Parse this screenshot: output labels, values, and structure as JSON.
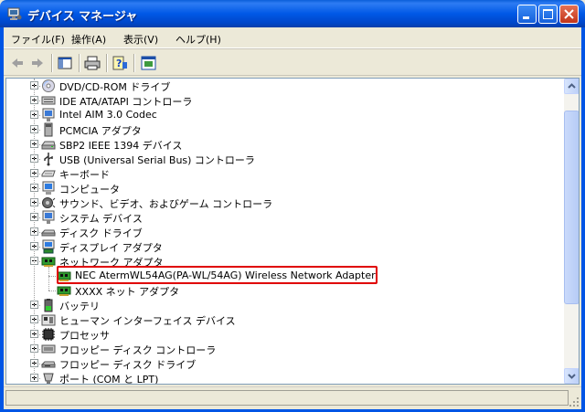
{
  "window": {
    "title": "デバイス マネージャ",
    "icon": "device-manager-icon"
  },
  "menu": [
    {
      "label": "ファイル(F)",
      "name": "menu-file"
    },
    {
      "label": "操作(A)",
      "name": "menu-action"
    },
    {
      "label": "表示(V)",
      "name": "menu-view"
    },
    {
      "label": "ヘルプ(H)",
      "name": "menu-help"
    }
  ],
  "toolbar": [
    {
      "name": "back-button",
      "icon": "arrow-left-icon"
    },
    {
      "name": "forward-button",
      "icon": "arrow-right-icon"
    },
    {
      "name": "show-hide-tree-button",
      "icon": "console-tree-icon"
    },
    {
      "name": "print-button",
      "icon": "printer-icon"
    },
    {
      "name": "help-button",
      "icon": "help-icon"
    },
    {
      "name": "properties-button",
      "icon": "properties-icon"
    }
  ],
  "tree": {
    "items": [
      {
        "label": "DVD/CD-ROM ドライブ",
        "icon": "cdrom-icon",
        "expander": "plus",
        "level": 1
      },
      {
        "label": "IDE ATA/ATAPI コントローラ",
        "icon": "ide-controller-icon",
        "expander": "plus",
        "level": 1
      },
      {
        "label": "Intel AIM 3.0 Codec",
        "icon": "monitor-icon",
        "expander": "plus",
        "level": 1
      },
      {
        "label": "PCMCIA アダプタ",
        "icon": "pcmcia-icon",
        "expander": "plus",
        "level": 1
      },
      {
        "label": "SBP2 IEEE 1394 デバイス",
        "icon": "drive-icon",
        "expander": "plus",
        "level": 1
      },
      {
        "label": "USB (Universal Serial Bus) コントローラ",
        "icon": "usb-icon",
        "expander": "plus",
        "level": 1
      },
      {
        "label": "キーボード",
        "icon": "keyboard-icon",
        "expander": "plus",
        "level": 1
      },
      {
        "label": "コンピュータ",
        "icon": "computer-icon",
        "expander": "plus",
        "level": 1
      },
      {
        "label": "サウンド、ビデオ、およびゲーム コントローラ",
        "icon": "sound-icon",
        "expander": "plus",
        "level": 1
      },
      {
        "label": "システム デバイス",
        "icon": "system-device-icon",
        "expander": "plus",
        "level": 1
      },
      {
        "label": "ディスク ドライブ",
        "icon": "disk-drive-icon",
        "expander": "plus",
        "level": 1
      },
      {
        "label": "ディスプレイ アダプタ",
        "icon": "display-adapter-icon",
        "expander": "plus",
        "level": 1
      },
      {
        "label": "ネットワーク アダプタ",
        "icon": "network-adapter-icon",
        "expander": "minus",
        "level": 1
      },
      {
        "label": "NEC AtermWL54AG(PA-WL/54AG) Wireless Network Adapter",
        "icon": "network-card-icon",
        "expander": "none",
        "level": 2,
        "highlighted": true
      },
      {
        "label": "XXXX ネット アダプタ",
        "icon": "network-card-icon",
        "expander": "none",
        "level": 2
      },
      {
        "label": "バッテリ",
        "icon": "battery-icon",
        "expander": "plus",
        "level": 1
      },
      {
        "label": "ヒューマン インターフェイス デバイス",
        "icon": "hid-icon",
        "expander": "plus",
        "level": 1
      },
      {
        "label": "プロセッサ",
        "icon": "processor-icon",
        "expander": "plus",
        "level": 1
      },
      {
        "label": "フロッピー ディスク コントローラ",
        "icon": "floppy-controller-icon",
        "expander": "plus",
        "level": 1
      },
      {
        "label": "フロッピー ディスク ドライブ",
        "icon": "floppy-drive-icon",
        "expander": "plus",
        "level": 1
      },
      {
        "label": "ポート (COM と LPT)",
        "icon": "port-icon",
        "expander": "plus",
        "level": 1
      }
    ]
  },
  "colors": {
    "titlebar": "#0055E5",
    "highlight_border": "#E00000"
  }
}
